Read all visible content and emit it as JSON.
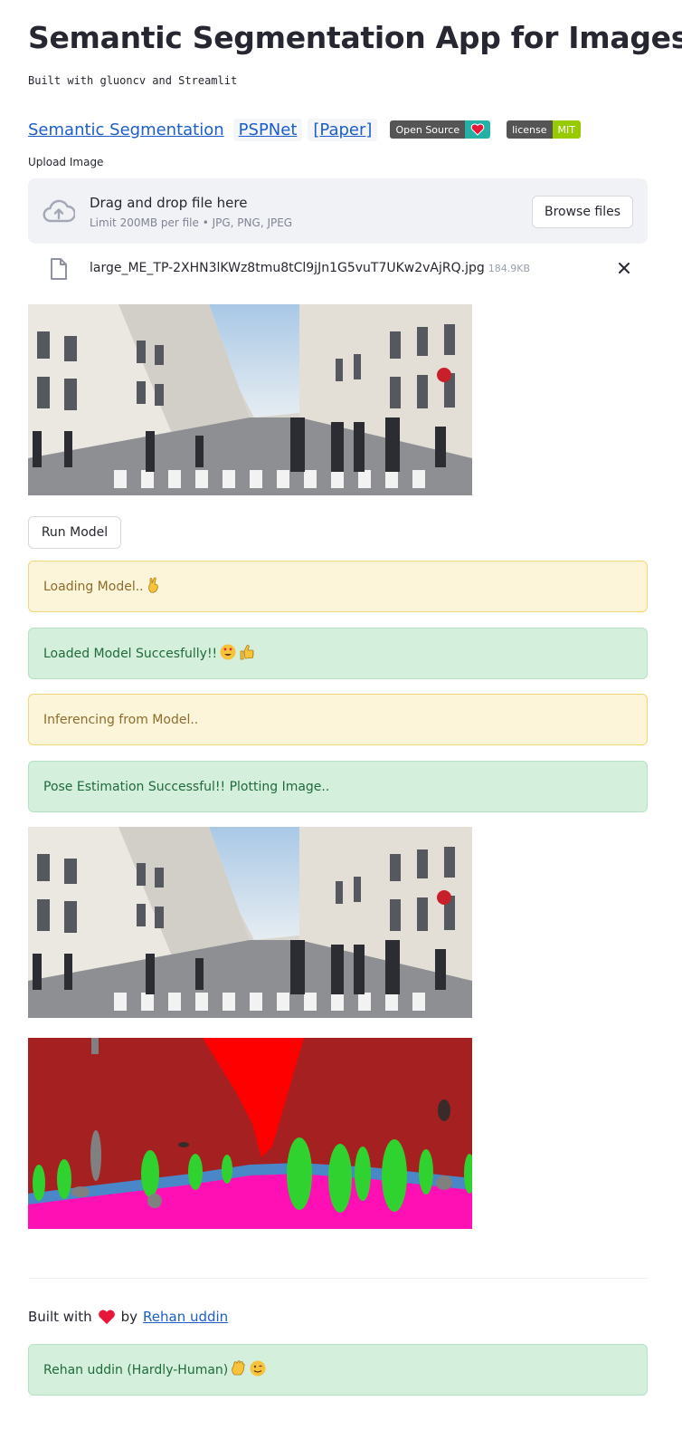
{
  "header": {
    "title": "Semantic Segmentation App for Images",
    "subtitle": "Built with gluoncv and Streamlit"
  },
  "links": {
    "semseg": "Semantic Segmentation",
    "pspnet": "PSPNet",
    "paper": "[Paper]"
  },
  "badges": {
    "open_source": "Open Source",
    "license_label": "license",
    "license_value": "MIT"
  },
  "uploader": {
    "label": "Upload Image",
    "drag_text": "Drag and drop file here",
    "limit_text": "Limit 200MB per file • JPG, PNG, JPEG",
    "browse_label": "Browse files",
    "file_name": "large_ME_TP-2XHN3lKWz8tmu8tCl9jJn1G5vuT7UKw2vAjRQ.jpg",
    "file_size": "184.9KB"
  },
  "run_button": "Run Model",
  "alerts": [
    {
      "text": "Loading Model..",
      "kind": "warning",
      "emoji": "fingers-crossed"
    },
    {
      "text": "Loaded Model Succesfully!!",
      "kind": "success",
      "emoji": "heart-eyes thumbs-up"
    },
    {
      "text": "Inferencing from Model..",
      "kind": "warning"
    },
    {
      "text": "Pose Estimation Successful!! Plotting Image..",
      "kind": "success"
    }
  ],
  "footer": {
    "built_with": "Built with",
    "by": "by",
    "author_link": "Rehan uddin",
    "credit": "Rehan uddin (Hardly-Human)"
  },
  "colors": {
    "link": "#1c5ec9",
    "warning_bg": "#fdf5d9",
    "success_bg": "#d5efdd",
    "seg_building": "#a52121",
    "seg_sky": "#ff0000",
    "seg_road": "#ff10b4",
    "seg_sidewalk": "#4a87c9",
    "seg_person": "#2fd22f",
    "seg_pole": "#808080"
  }
}
